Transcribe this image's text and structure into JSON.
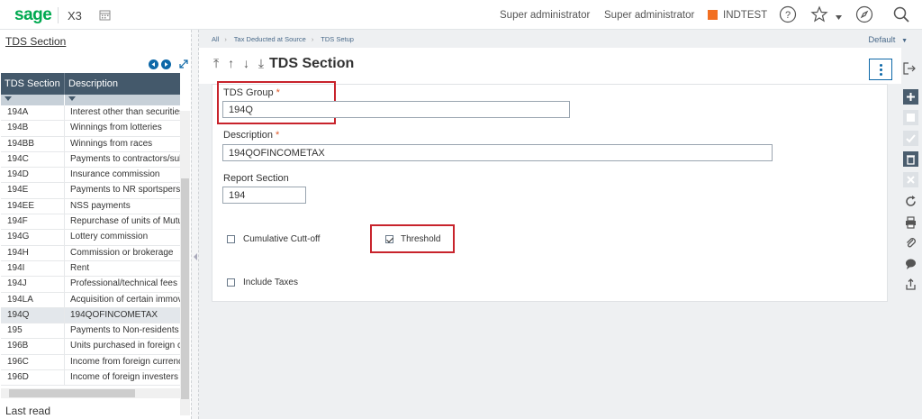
{
  "header": {
    "logo": "sage",
    "product": "X3",
    "user_1": "Super administrator",
    "user_2": "Super administrator",
    "folder": "INDTEST",
    "icons": [
      "calendar-icon",
      "help-icon",
      "star-icon",
      "compass-icon",
      "search-icon"
    ],
    "accent": "#00a950",
    "folder_color": "#f26f21"
  },
  "left_panel": {
    "title": "TDS Section",
    "columns": [
      "TDS Section",
      "Description"
    ],
    "rows": [
      {
        "code": "194A",
        "desc": "Interest other than securities"
      },
      {
        "code": "194B",
        "desc": "Winnings from lotteries"
      },
      {
        "code": "194BB",
        "desc": "Winnings from races"
      },
      {
        "code": "194C",
        "desc": "Payments to contractors/sub-"
      },
      {
        "code": "194D",
        "desc": "Insurance commission"
      },
      {
        "code": "194E",
        "desc": "Payments to NR sportsperson"
      },
      {
        "code": "194EE",
        "desc": "NSS payments"
      },
      {
        "code": "194F",
        "desc": "Repurchase of units of Mutua"
      },
      {
        "code": "194G",
        "desc": "Lottery commission"
      },
      {
        "code": "194H",
        "desc": "Commission or brokerage"
      },
      {
        "code": "194I",
        "desc": "Rent"
      },
      {
        "code": "194J",
        "desc": "Professional/technical fees"
      },
      {
        "code": "194LA",
        "desc": "Acquisition of certain immova"
      },
      {
        "code": "194Q",
        "desc": "194QOFINCOMETAX"
      },
      {
        "code": "195",
        "desc": "Payments to Non-residents"
      },
      {
        "code": "196B",
        "desc": "Units purchased in foreign cu"
      },
      {
        "code": "196C",
        "desc": "Income from foreign currency"
      },
      {
        "code": "196D",
        "desc": "Income of foreign investers"
      }
    ],
    "footer": "Last read"
  },
  "breadcrumb": [
    "All",
    "Tax Deducted at Source",
    "TDS Setup"
  ],
  "view_selector": "Default",
  "page": {
    "title": "TDS Section",
    "arrows": "⤒ ↑ ↓ ⤓"
  },
  "form": {
    "tds_group_label": "TDS Group",
    "tds_group_value": "194Q",
    "description_label": "Description",
    "description_value": "194QOFINCOMETAX",
    "report_section_label": "Report Section",
    "report_section_value": "194",
    "cumulative_label": "Cumulative Cutt-off",
    "threshold_label": "Threshold",
    "include_taxes_label": "Include Taxes",
    "required_mark": "*"
  }
}
